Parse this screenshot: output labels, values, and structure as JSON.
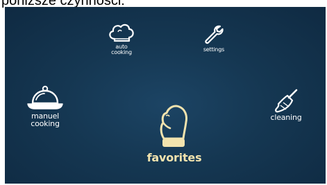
{
  "caption": "poniższe czynności:",
  "menu": {
    "auto_cooking": {
      "label_line1": "auto",
      "label_line2": "cooking",
      "icon": "chef-hat-icon"
    },
    "settings": {
      "label": "settings",
      "icon": "wrench-icon"
    },
    "manual_cooking": {
      "label_line1": "manuel",
      "label_line2": "cooking",
      "icon": "cloche-icon"
    },
    "cleaning": {
      "label": "cleaning",
      "icon": "brush-icon"
    },
    "favorites": {
      "label": "favorites",
      "icon": "oven-mitt-icon"
    }
  },
  "colors": {
    "background": "#153752",
    "icon_white": "#ffffff",
    "icon_highlight": "#f2e3ae"
  }
}
